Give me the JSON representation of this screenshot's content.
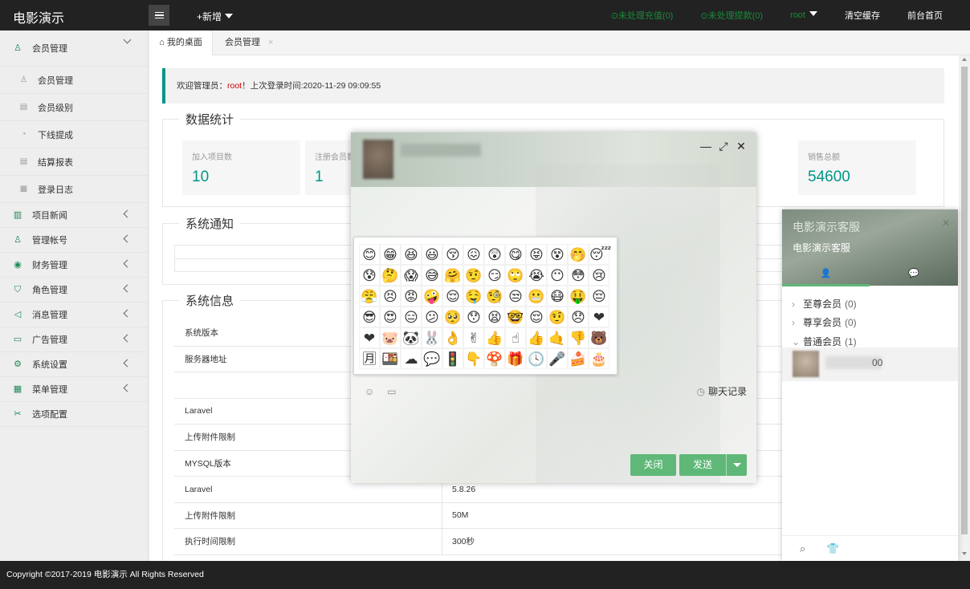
{
  "topbar": {
    "logo": "电影演示",
    "add_new": "+新增",
    "unhandled_recharge": "⊙未处理充值(0)",
    "unhandled_withdraw": "⊙未处理提款(0)",
    "user": "root",
    "clear_cache": "清空缓存",
    "home": "前台首页"
  },
  "sidebar": {
    "member_mgmt": "会员管理",
    "sub_items": [
      "会员管理",
      "会员级别",
      "下线提成",
      "结算报表",
      "登录日志"
    ],
    "items": [
      "项目新闻",
      "管理帐号",
      "财务管理",
      "角色管理",
      "消息管理",
      "广告管理",
      "系统设置",
      "菜单管理",
      "选项配置"
    ]
  },
  "tabs": {
    "desktop": "我的桌面",
    "member": "会员管理",
    "close": "×"
  },
  "welcome": {
    "prefix": "欢迎管理员：",
    "user": "root",
    "suffix": "！上次登录时间:2020-11-29 09:09:55"
  },
  "stats": {
    "title": "数据统计",
    "cards": [
      {
        "label": "加入项目数",
        "value": "10"
      },
      {
        "label": "注册会员数",
        "value": "1"
      },
      {
        "label": "销售总额",
        "value": "54600"
      }
    ]
  },
  "notice": {
    "title": "系统通知"
  },
  "sysinfo": {
    "title": "系统信息",
    "rows": [
      {
        "k": "系统版本",
        "v": ""
      },
      {
        "k": "服务器地址",
        "v": ""
      },
      {
        "k": "",
        "v": ""
      },
      {
        "k": "Laravel",
        "v": ""
      },
      {
        "k": "上传附件限制",
        "v": ""
      },
      {
        "k": "MYSQL版本",
        "v": ""
      },
      {
        "k": "Laravel",
        "v": "5.8.26"
      },
      {
        "k": "上传附件限制",
        "v": "50M"
      },
      {
        "k": "执行时间限制",
        "v": "300秒"
      }
    ]
  },
  "footer": {
    "copyright": "Copyright ©2017-2019 电影演示 All Rights Reserved"
  },
  "chat": {
    "history": "聊天记录",
    "close": "关闭",
    "send": "发送",
    "emojis": [
      "😊",
      "😁",
      "😆",
      "😃",
      "😚",
      "😖",
      "😲",
      "😋",
      "😝",
      "😵",
      "🤭",
      "😴",
      "😰",
      "🤔",
      "😱",
      "😅",
      "🤗",
      "🤨",
      "😏",
      "🙄",
      "😭",
      "😶",
      "😳",
      "😢",
      "😤",
      "😣",
      "😡",
      "🤪",
      "😌",
      "🤤",
      "🧐",
      "😒",
      "😬",
      "😷",
      "🤑",
      "😔",
      "😎",
      "😍",
      "😑",
      "😕",
      "🥺",
      "😯",
      "😫",
      "🤓",
      "😌",
      "🤨",
      "😞",
      "❤",
      "❤",
      "🐷",
      "🐼",
      "🐰",
      "👌",
      "✌",
      "👍",
      "☝",
      "👍",
      "🤙",
      "👎",
      "🐻",
      "🈷",
      "🍱",
      "☁",
      "💬",
      "🚦",
      "👇",
      "🍄",
      "🎁",
      "🕓",
      "🎤",
      "🍰",
      "🎂"
    ]
  },
  "cs": {
    "title": "电影演示客服",
    "subtitle": "电影演示客服",
    "groups": [
      {
        "name": "至尊会员",
        "count": "(0)"
      },
      {
        "name": "尊享会员",
        "count": "(0)"
      },
      {
        "name": "普通会员",
        "count": "(1)"
      }
    ],
    "friend_tail": "00"
  }
}
